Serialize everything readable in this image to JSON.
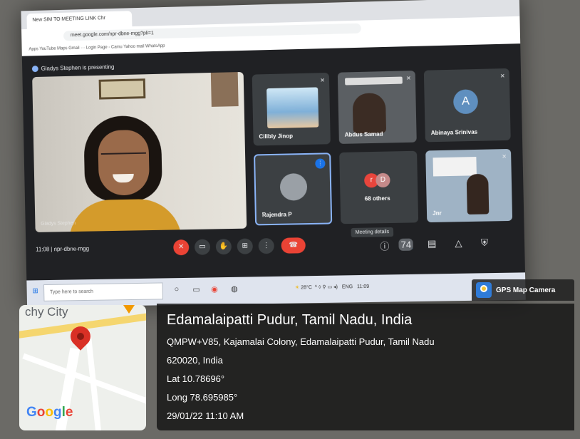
{
  "browser": {
    "tab_title": "New SIM TO MEETING LINK Chr",
    "url": "meet.google.com/npr-dbne-mgg?pli=1",
    "bookmarks": "Apps   YouTube   Maps   Gmail  ···  Login Page - Camu   Yahoo mail   WhatsApp"
  },
  "meet": {
    "presenting_label": "Gladys Stephen is presenting",
    "main_name": "Gladys Stephen",
    "tiles": [
      {
        "name": "Cillbly Jinop"
      },
      {
        "name": "Abdus Samad"
      },
      {
        "name": "Abinaya Srinivas",
        "initial": "A"
      },
      {
        "name": "Rajendra P"
      },
      {
        "name": "68 others",
        "initials": [
          "r",
          "D"
        ]
      },
      {
        "name": "Jnr"
      }
    ],
    "time_code": "11:08 | npr-dbne-mgg",
    "tooltip": "Meeting details",
    "participants_badge": "74"
  },
  "taskbar": {
    "search_placeholder": "Type here to search",
    "weather": "28°C",
    "lang": "ENG",
    "clock": "11:09"
  },
  "gps": {
    "app_name": "GPS Map Camera",
    "title": "Edamalaipatti Pudur, Tamil Nadu, India",
    "address_line1": "QMPW+V85, Kajamalai Colony, Edamalaipatti Pudur, Tamil Nadu",
    "address_line2": "620020, India",
    "lat": "Lat 10.78696°",
    "long": "Long 78.695985°",
    "datetime": "29/01/22 11:10 AM",
    "map_city_label": "chy City",
    "map_brand": [
      "G",
      "o",
      "o",
      "g",
      "l",
      "e"
    ]
  },
  "colors": {
    "meet_bg": "#202124",
    "end_call": "#ea4335",
    "panel_bg": "#141414"
  }
}
